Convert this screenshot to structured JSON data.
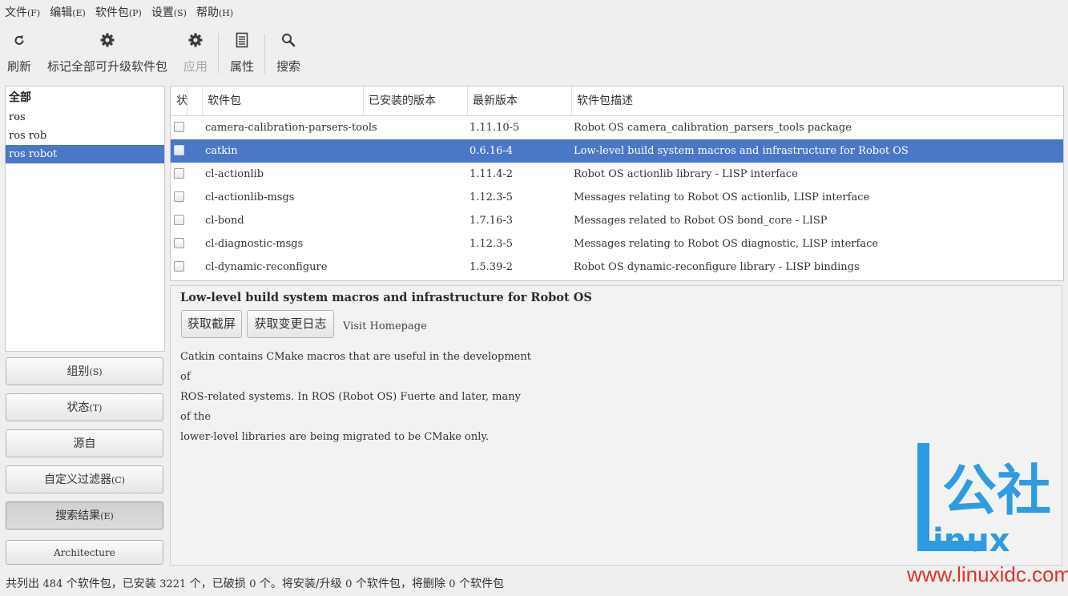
{
  "menubar": [
    {
      "label": "文件",
      "accel": "(F)"
    },
    {
      "label": "编辑",
      "accel": "(E)"
    },
    {
      "label": "软件包",
      "accel": "(P)"
    },
    {
      "label": "设置",
      "accel": "(S)"
    },
    {
      "label": "帮助",
      "accel": "(H)"
    }
  ],
  "toolbar": {
    "refresh": {
      "label": "刷新",
      "icon": "refresh-icon"
    },
    "mark_all": {
      "label": "标记全部可升级软件包",
      "icon": "gear-icon"
    },
    "apply": {
      "label": "应用",
      "icon": "gear-icon",
      "disabled": true
    },
    "properties": {
      "label": "属性",
      "icon": "document-icon"
    },
    "search": {
      "label": "搜索",
      "icon": "search-icon"
    }
  },
  "filter_list": {
    "header": "全部",
    "items": [
      "ros",
      "ros rob",
      "ros robot"
    ],
    "selected": "ros robot"
  },
  "side_buttons": {
    "sections": {
      "label": "组别",
      "accel": "(S)"
    },
    "status": {
      "label": "状态",
      "accel": "(T)"
    },
    "origin": {
      "label": "源自"
    },
    "custom_filters": {
      "label": "自定义过滤器",
      "accel": "(C)"
    },
    "search_results": {
      "label": "搜索结果",
      "accel": "(E)"
    },
    "architecture": {
      "label": "Architecture"
    }
  },
  "table": {
    "columns": [
      "状",
      "软件包",
      "已安装的版本",
      "最新版本",
      "软件包描述"
    ],
    "rows": [
      {
        "name": "camera-calibration-parsers-tools",
        "installed": "",
        "latest": "1.11.10-5",
        "description": "Robot OS camera_calibration_parsers_tools package"
      },
      {
        "name": "catkin",
        "installed": "",
        "latest": "0.6.16-4",
        "description": "Low-level build system macros and infrastructure for Robot OS",
        "selected": true
      },
      {
        "name": "cl-actionlib",
        "installed": "",
        "latest": "1.11.4-2",
        "description": "Robot OS actionlib library - LISP interface"
      },
      {
        "name": "cl-actionlib-msgs",
        "installed": "",
        "latest": "1.12.3-5",
        "description": "Messages relating to Robot OS actionlib, LISP interface"
      },
      {
        "name": "cl-bond",
        "installed": "",
        "latest": "1.7.16-3",
        "description": "Messages related to Robot OS bond_core - LISP"
      },
      {
        "name": "cl-diagnostic-msgs",
        "installed": "",
        "latest": "1.12.3-5",
        "description": "Messages relating to Robot OS diagnostic, LISP interface"
      },
      {
        "name": "cl-dynamic-reconfigure",
        "installed": "",
        "latest": "1.5.39-2",
        "description": "Robot OS dynamic-reconfigure library - LISP bindings"
      }
    ]
  },
  "details": {
    "title": "Low-level build system macros and infrastructure for Robot OS",
    "screenshot_button": "获取截屏",
    "changelog_button": "获取变更日志",
    "homepage_link": "Visit Homepage",
    "description_lines": [
      "Catkin contains CMake macros that are useful in the development of",
      "ROS-related systems. In ROS (Robot OS) Fuerte and later, many of the",
      "lower-level libraries are being migrated to be CMake only."
    ]
  },
  "statusbar": {
    "p1": "共列出 ",
    "listed": "484",
    "p2": " 个软件包，已安装 ",
    "installed": "3221",
    "p3": " 个，已破损 ",
    "broken": "0",
    "p4": " 个。将安装/升级 ",
    "to_install": "0",
    "p5": " 个软件包，将删除 ",
    "to_remove": "0",
    "p6": " 个软件包"
  },
  "watermark": {
    "chinese": "公社",
    "brand_letter": "L",
    "brand_rest": "inux",
    "url": "www.linuxidc.com",
    "colors": {
      "blue": "#2f9be0",
      "red": "#e03030"
    }
  },
  "colors": {
    "selection": "#4a77c6",
    "background": "#efefef"
  }
}
